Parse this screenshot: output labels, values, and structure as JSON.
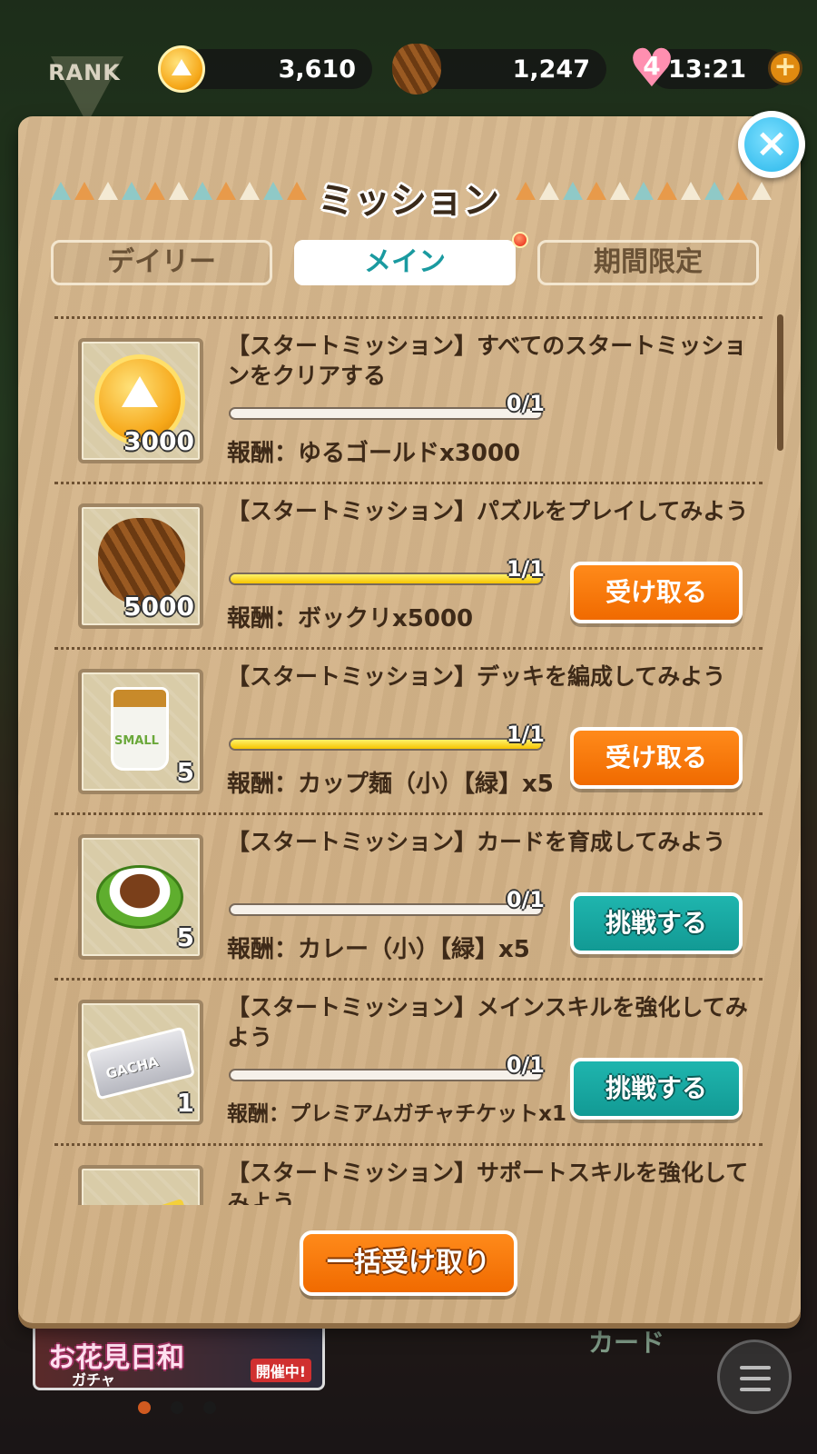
{
  "topbar": {
    "rank_label": "RANK",
    "gold_amount": "3,610",
    "pinecone_amount": "1,247",
    "hearts_count": "4",
    "stamina_timer": "13:21",
    "plus_label": "+"
  },
  "dialog": {
    "title": "ミッション",
    "close_label": "×",
    "tabs": [
      {
        "label": "デイリー",
        "active": false
      },
      {
        "label": "メイン",
        "active": true
      },
      {
        "label": "期間限定",
        "active": false
      }
    ],
    "bulk_claim_label": "一括受け取り"
  },
  "missions": [
    {
      "title": "【スタートミッション】すべてのスタートミッションをクリアする",
      "progress_text": "0/1",
      "progress": 0,
      "reward": "報酬：ゆるゴールドx3000",
      "item_qty": "3000",
      "item_icon": "gold-coin-icon",
      "button": ""
    },
    {
      "title": "【スタートミッション】パズルをプレイしてみよう",
      "progress_text": "1/1",
      "progress": 1,
      "reward": "報酬：ボックリx5000",
      "item_qty": "5000",
      "item_icon": "pinecone-icon",
      "button": "受け取る"
    },
    {
      "title": "【スタートミッション】デッキを編成してみよう",
      "progress_text": "1/1",
      "progress": 1,
      "reward": "報酬：カップ麺（小）【緑】x5",
      "item_qty": "5",
      "item_icon": "cup-noodle-icon",
      "item_text": "SMALL",
      "button": "受け取る"
    },
    {
      "title": "【スタートミッション】カードを育成してみよう",
      "progress_text": "0/1",
      "progress": 0,
      "reward": "報酬：カレー（小）【緑】x5",
      "item_qty": "5",
      "item_icon": "curry-bowl-icon",
      "button": "挑戦する"
    },
    {
      "title": "【スタートミッション】メインスキルを強化してみよう",
      "progress_text": "0/1",
      "progress": 0,
      "reward": "報酬：プレミアムガチャチケットx1",
      "item_qty": "1",
      "item_icon": "gacha-ticket-icon",
      "item_text": "GACHA",
      "button": "挑戦する"
    },
    {
      "title": "【スタートミッション】サポートスキルを強化してみよう",
      "item_icon": "yellow-item-icon"
    }
  ],
  "background": {
    "banner_title": "お花見日和",
    "banner_sub": "ガチャ",
    "banner_badge": "開催中!",
    "card_label": "カード"
  },
  "colors": {
    "claim_button": "#f57a00",
    "challenge_button": "#17a8a2",
    "panel": "#d4b488",
    "active_tab_text": "#1a9aa0"
  }
}
